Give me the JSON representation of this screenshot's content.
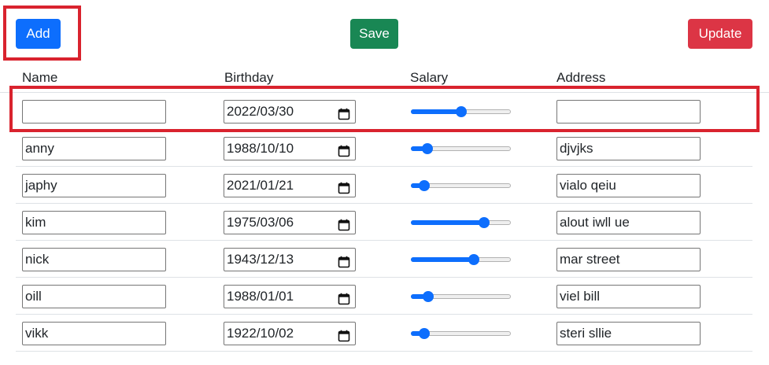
{
  "toolbar": {
    "add_label": "Add",
    "save_label": "Save",
    "update_label": "Update"
  },
  "columns": {
    "name": "Name",
    "birthday": "Birthday",
    "salary": "Salary",
    "address": "Address"
  },
  "rows": [
    {
      "name": "",
      "birthday": "2022/03/30",
      "salary": 0.5,
      "address": ""
    },
    {
      "name": "anny",
      "birthday": "1988/10/10",
      "salary": 0.12,
      "address": "djvjks"
    },
    {
      "name": "japhy",
      "birthday": "2021/01/21",
      "salary": 0.09,
      "address": "vialo qeiu"
    },
    {
      "name": "kim",
      "birthday": "1975/03/06",
      "salary": 0.76,
      "address": "alout iwll ue"
    },
    {
      "name": "nick",
      "birthday": "1943/12/13",
      "salary": 0.65,
      "address": "mar street"
    },
    {
      "name": "oill",
      "birthday": "1988/01/01",
      "salary": 0.13,
      "address": "viel bill"
    },
    {
      "name": "vikk",
      "birthday": "1922/10/02",
      "salary": 0.09,
      "address": "steri sllie"
    }
  ],
  "colors": {
    "add": "#0d6efd",
    "save": "#198754",
    "update": "#dc3545",
    "highlight": "#d9232e"
  },
  "icons": {
    "date_picker": "calendar-icon"
  }
}
